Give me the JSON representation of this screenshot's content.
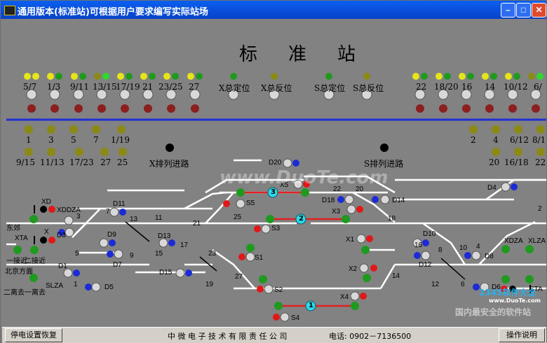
{
  "window": {
    "title": "通用版本(标准站)可根据用户要求编写实际站场",
    "buttons": {
      "minimize": "–",
      "maximize": "□",
      "close": "✕"
    }
  },
  "station": {
    "title": "标准站"
  },
  "top_switch_labels_left": [
    "5/7",
    "1/3",
    "9/11",
    "13/15",
    "17/19",
    "21",
    "23/25",
    "27"
  ],
  "top_switch_labels_right": [
    "22",
    "18/20",
    "16",
    "14",
    "10/12",
    "6/"
  ],
  "total_controls": [
    "X总定位",
    "X总反位",
    "S总定位",
    "S总反位"
  ],
  "route_labels_left": [
    "1",
    "3",
    "5",
    "7",
    "1/19",
    "9/15",
    "11/13",
    "17/23",
    "27",
    "25"
  ],
  "route_labels_right": [
    "2",
    "4",
    "6/12",
    "8/1",
    "20",
    "16/18",
    "22"
  ],
  "route_rows": {
    "x": "X排列进路",
    "s": "S排列进路"
  },
  "yard_labels": {
    "XD": "XD",
    "XDDZA": "XDDZA",
    "dongjiao": "东郊",
    "XTA": "XTA",
    "X": "X",
    "D3": "D3",
    "D9": "D9",
    "D7": "D7",
    "D11": "D11",
    "D13": "D13",
    "D15": "D15",
    "D1": "D1",
    "D5": "D5",
    "SLZA": "SLZA",
    "jiejin": "一接近",
    "erjiejin": "二接近",
    "beijing": "北京方面",
    "erliqu": "二离去一离去",
    "D20": "D20",
    "X5": "X5",
    "S5": "S5",
    "X3": "X3",
    "S3": "S3",
    "D18": "D18",
    "D14": "D14",
    "S1": "S1",
    "X1": "X1",
    "X2": "X2",
    "S2": "S2",
    "X4": "X4",
    "S4": "S4",
    "D10": "D10",
    "D12": "D12",
    "D8": "D8",
    "D6": "D6",
    "D4": "D4",
    "XDZA": "XDZA",
    "XLZA": "XLZA",
    "STA": "STA",
    "n1": "1",
    "n3": "3",
    "n5": "5",
    "n7": "7",
    "n9": "9",
    "n11": "11",
    "n13": "13",
    "n15": "15",
    "n17": "17",
    "n19": "19",
    "n21": "21",
    "n23": "23",
    "n25": "25",
    "n27": "27",
    "n2": "2",
    "n4": "4",
    "n6": "6",
    "n8": "8",
    "n10": "10",
    "n12": "12",
    "n14": "14",
    "n16": "16",
    "n18": "18",
    "n20": "20",
    "n22": "22",
    "t1": "1",
    "t2": "2",
    "t3": "3"
  },
  "watermark": {
    "url": "www.DuoTe.com",
    "logo": "2345软件大全",
    "slogan": "国内最安全的软件站",
    "site": "www.DuoTe.com"
  },
  "status": {
    "left_button": "停电设置恢复",
    "company": "中 微 电 子 技 术 有 限 责 任 公 司",
    "phone": "电话: 0902－7136500",
    "right_button": "操作说明"
  },
  "colors": {
    "bg": "#828282",
    "track": "#ffffff",
    "route": "#e02020",
    "signal_green": "#1f9a1f",
    "signal_red": "#e01818",
    "signal_blue": "#1b2bd6",
    "lamp_yellow": "#e5e51a",
    "lamp_olive": "#8a8a14",
    "lamp_darkred": "#8c1f1f",
    "divider": "#1f2fd2"
  },
  "icons": {
    "app": "signal-app-icon",
    "minimize": "minimize-icon",
    "maximize": "maximize-icon",
    "close": "close-icon"
  }
}
